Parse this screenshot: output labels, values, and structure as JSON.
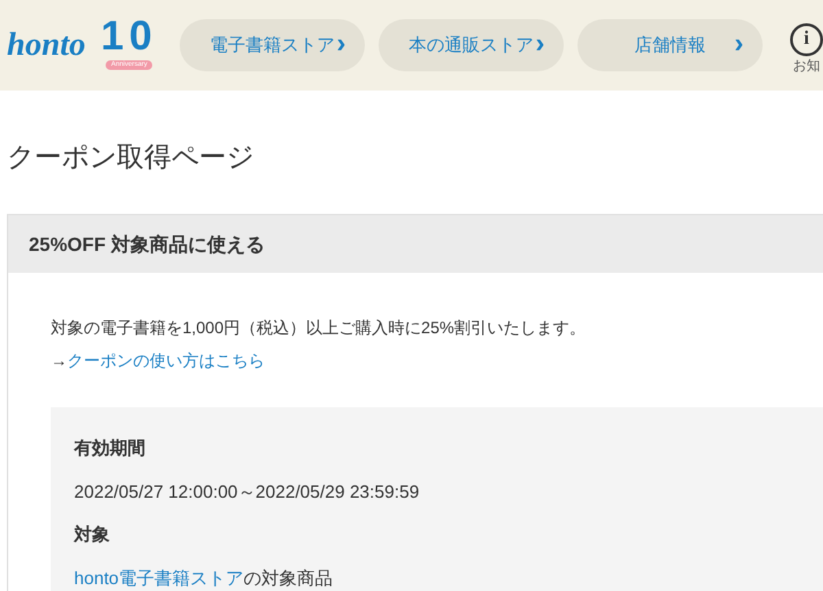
{
  "header": {
    "logo": "honto",
    "anniversary": {
      "number": "10",
      "ribbon": "Anniversary"
    },
    "nav": [
      {
        "label": "電子書籍ストア",
        "arrow": "›"
      },
      {
        "label": "本の通販ストア",
        "arrow": "›"
      },
      {
        "label": "店舗情報",
        "arrow": "›"
      }
    ],
    "info": {
      "icon": "i",
      "label": "お知"
    }
  },
  "page_title": "クーポン取得ページ",
  "coupon": {
    "title": "25%OFF 対象商品に使える",
    "description": "対象の電子書籍を1,000円（税込）以上ご購入時に25%割引いたします。",
    "howto": {
      "prefix": "→",
      "link": "クーポンの使い方はこちら"
    },
    "details": [
      {
        "heading": "有効期間",
        "text": "2022/05/27 12:00:00～2022/05/29 23:59:59"
      },
      {
        "heading": "対象",
        "link": "honto電子書籍ストア",
        "text": "の対象商品"
      }
    ]
  }
}
